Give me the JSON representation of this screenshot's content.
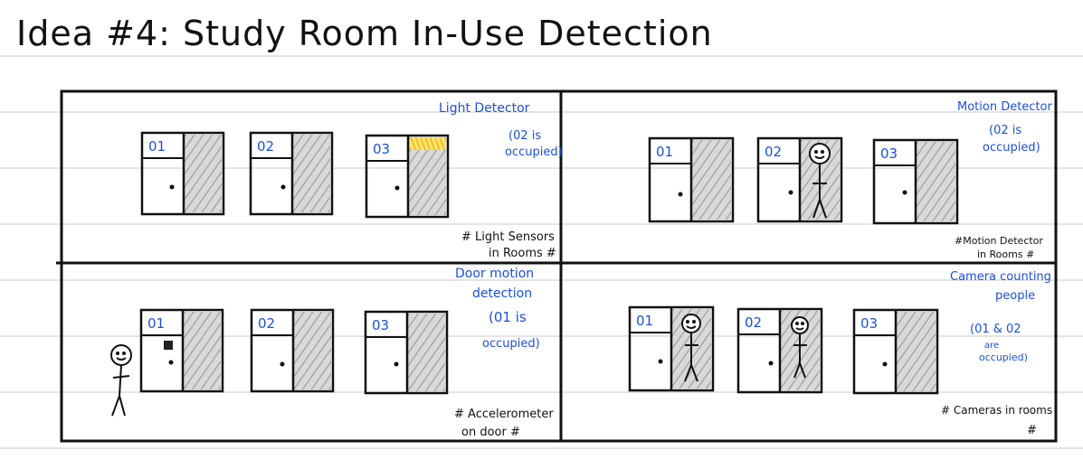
{
  "page": {
    "title": "Idea #4: Study Room In-Use Detection"
  },
  "colors": {
    "ink": "#111111",
    "annotation": "#1c4fe0",
    "light": "#f2c200",
    "rule_line": "#c8c8c8",
    "glass": "#b5b5b5"
  },
  "panels": [
    {
      "id": "light",
      "heading": "Light Detector",
      "status_line1": "(02 is",
      "status_line2": "occupied)",
      "note_line1": "# Light Sensors",
      "note_line2": "in Rooms #",
      "rooms": [
        {
          "number": "01",
          "occupied": false
        },
        {
          "number": "02",
          "occupied": false
        },
        {
          "number": "03",
          "occupied": false,
          "light_on": true
        }
      ]
    },
    {
      "id": "motion",
      "heading": "Motion Detector",
      "status_line1": "(02 is",
      "status_line2": "occupied)",
      "note_line1": "#Motion Detector",
      "note_line2": "in Rooms #",
      "rooms": [
        {
          "number": "01",
          "occupied": false
        },
        {
          "number": "02",
          "occupied": true
        },
        {
          "number": "03",
          "occupied": false
        }
      ]
    },
    {
      "id": "door",
      "heading_line1": "Door motion",
      "heading_line2": "detection",
      "status_line1": "(01 is",
      "status_line2": "occupied)",
      "note_line1": "# Accelerometer",
      "note_line2": "on door #",
      "rooms": [
        {
          "number": "01",
          "occupied": false,
          "sensor_on_door": true
        },
        {
          "number": "02",
          "occupied": false
        },
        {
          "number": "03",
          "occupied": false
        }
      ]
    },
    {
      "id": "camera",
      "heading_line1": "Camera counting",
      "heading_line2": "people",
      "status_line1": "(01 & 02",
      "status_line2": "are",
      "status_line3": "occupied)",
      "note_line1": "# Cameras in rooms",
      "note_line2": "#",
      "rooms": [
        {
          "number": "01",
          "occupied": true
        },
        {
          "number": "02",
          "occupied": true
        },
        {
          "number": "03",
          "occupied": false
        }
      ]
    }
  ]
}
